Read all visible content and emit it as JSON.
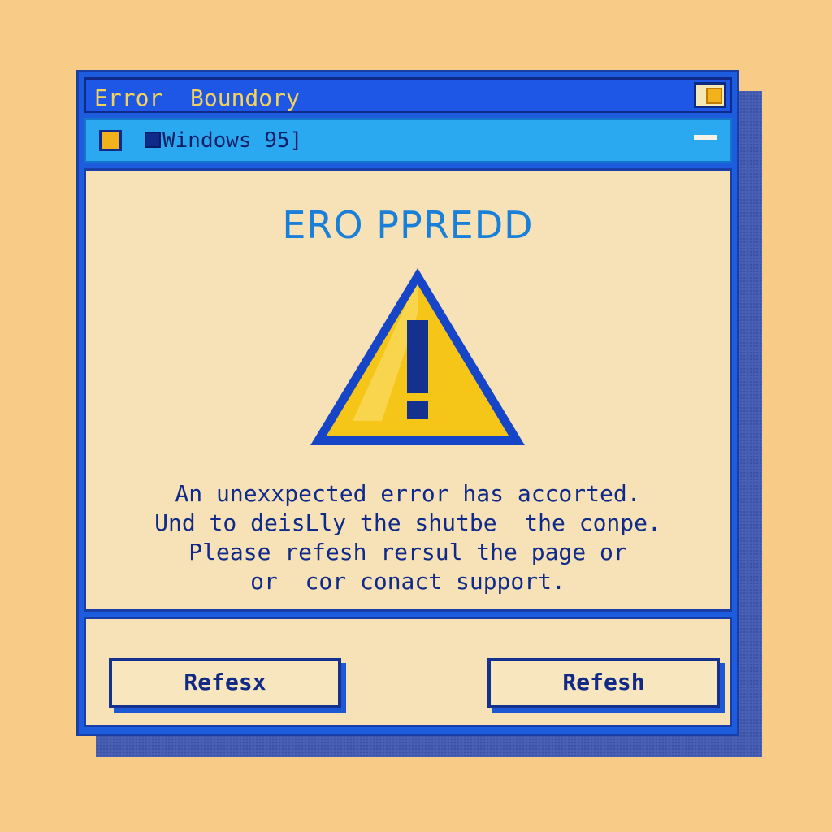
{
  "window": {
    "title": "Error  Boundory",
    "menu_label": "Windows 95]"
  },
  "content": {
    "headline": "ERO PPREDD",
    "message_lines": [
      "An unexxpected error has accorted.",
      "Und to deisLly the shutbe  the conpe.",
      "Please refesh rersul the page or",
      "or  cor conact support."
    ]
  },
  "footer": {
    "left_button": "Refesx",
    "right_button": "Refesh"
  },
  "icons": {
    "warning": "warning-triangle-icon",
    "title_button": "maximize-icon",
    "menu_app": "app-icon"
  },
  "colors": {
    "background": "#f8cc86",
    "title_bar": "#1e57e6",
    "menu_bar": "#2aa8f0",
    "panel": "#f6e2b6",
    "warning_fill": "#f5c518",
    "text_dark": "#102a8a",
    "headline": "#1a7fd8"
  }
}
